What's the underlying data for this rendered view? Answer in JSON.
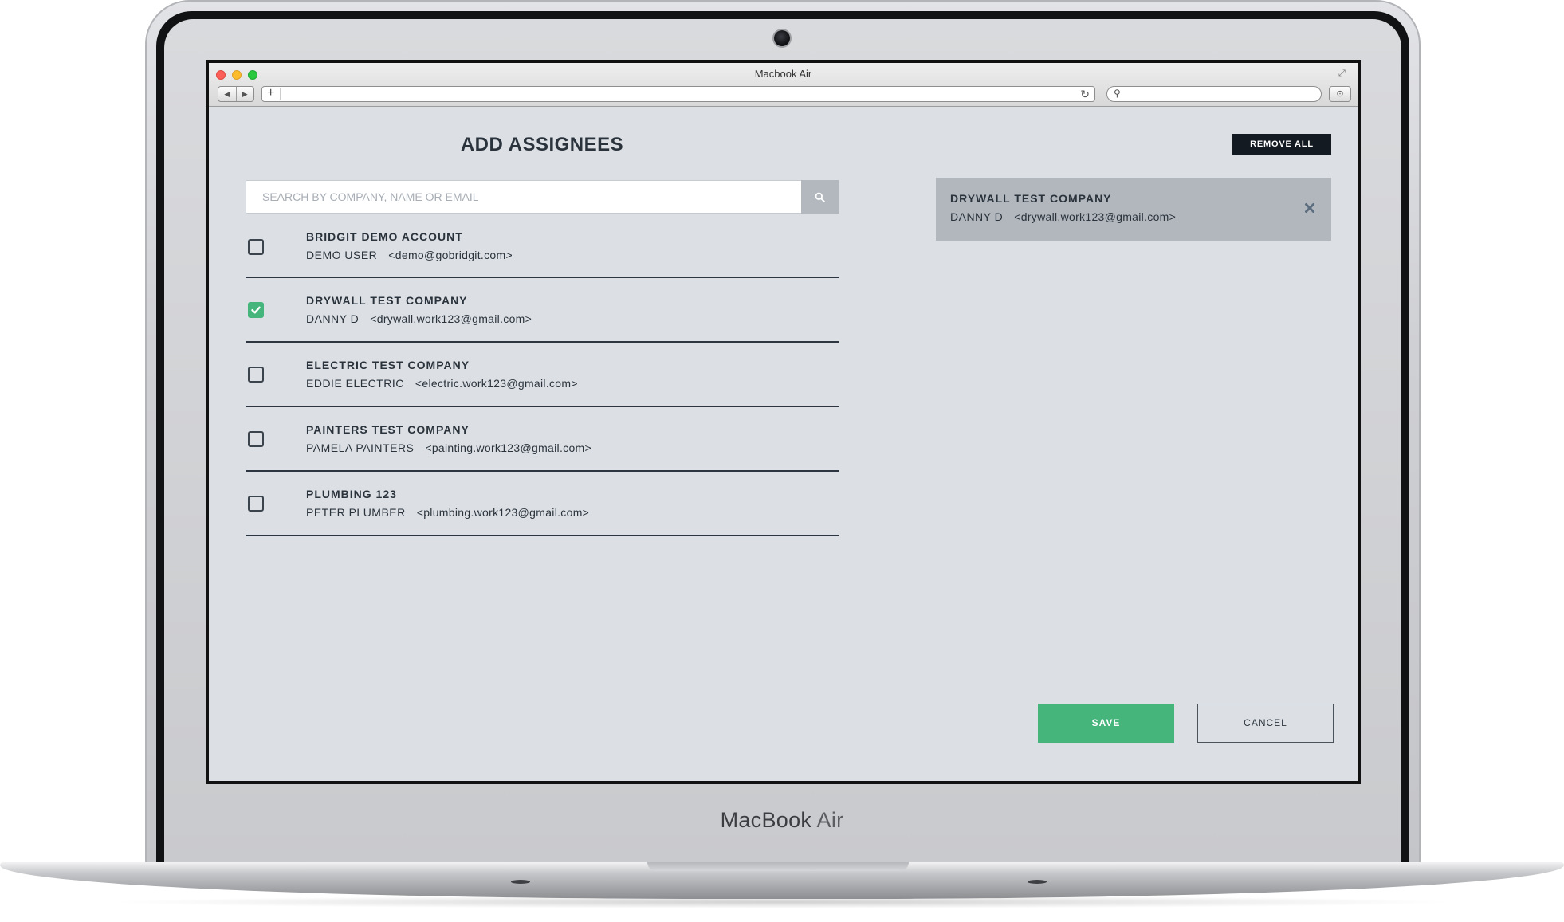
{
  "device": {
    "label_brand": "MacBook",
    "label_model": "Air"
  },
  "browser": {
    "window_title": "Macbook Air",
    "url": "",
    "search_query": ""
  },
  "app": {
    "title": "ADD ASSIGNEES",
    "search": {
      "placeholder": "SEARCH BY COMPANY, NAME OR EMAIL",
      "value": ""
    },
    "results": [
      {
        "company": "BRIDGIT DEMO ACCOUNT",
        "contact": "DEMO USER",
        "email": "<demo@gobridgit.com>",
        "checked": false
      },
      {
        "company": "DRYWALL TEST COMPANY",
        "contact": "DANNY D",
        "email": "<drywall.work123@gmail.com>",
        "checked": true
      },
      {
        "company": "ELECTRIC TEST COMPANY",
        "contact": "EDDIE ELECTRIC",
        "email": "<electric.work123@gmail.com>",
        "checked": false
      },
      {
        "company": "PAINTERS TEST COMPANY",
        "contact": "PAMELA PAINTERS",
        "email": "<painting.work123@gmail.com>",
        "checked": false
      },
      {
        "company": "PLUMBING 123",
        "contact": "PETER PLUMBER",
        "email": "<plumbing.work123@gmail.com>",
        "checked": false
      }
    ],
    "remove_all_label": "REMOVE ALL",
    "selected": [
      {
        "company": "DRYWALL TEST COMPANY",
        "contact": "DANNY D",
        "email": "<drywall.work123@gmail.com>"
      }
    ],
    "save_label": "SAVE",
    "cancel_label": "CANCEL"
  },
  "colors": {
    "page_background": "#dce0e5",
    "text_dark": "#2a323b",
    "accent_green": "#45b57c",
    "button_dark": "#131a22",
    "selected_card": "#b2b7bd"
  },
  "icons": {
    "search_button": "search-icon",
    "remove_selected": "close-icon",
    "checked_box": "checkmark-icon"
  }
}
